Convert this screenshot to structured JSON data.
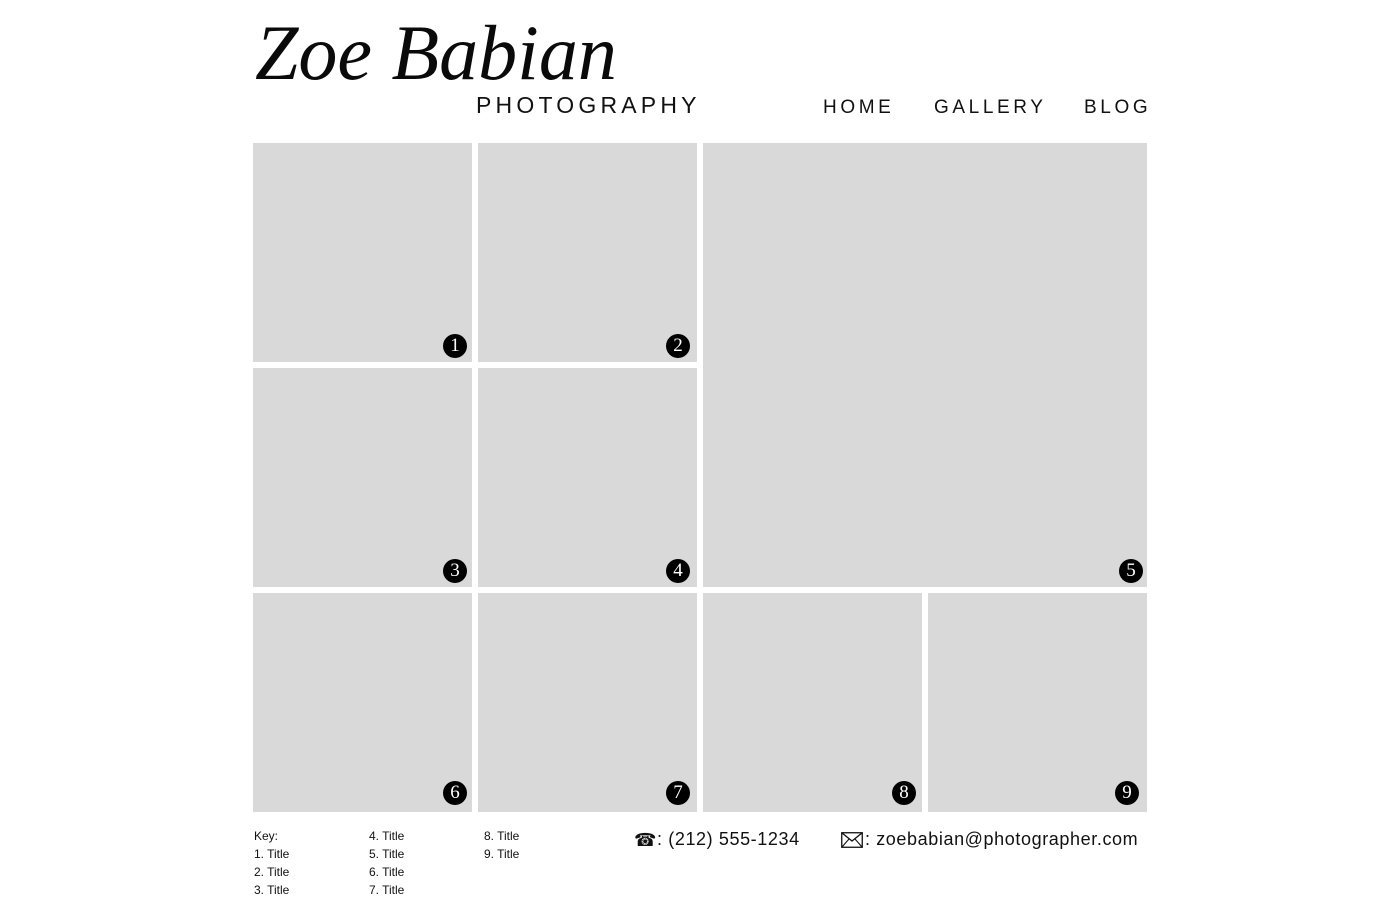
{
  "header": {
    "logo_name": "Zoe Babian",
    "logo_sub": "PHOTOGRAPHY",
    "nav": [
      {
        "label": "HOME"
      },
      {
        "label": "GALLERY"
      },
      {
        "label": "BLOG"
      }
    ]
  },
  "gallery": {
    "tiles": [
      {
        "number": "1"
      },
      {
        "number": "2"
      },
      {
        "number": "3"
      },
      {
        "number": "4"
      },
      {
        "number": "5"
      },
      {
        "number": "6"
      },
      {
        "number": "7"
      },
      {
        "number": "8"
      },
      {
        "number": "9"
      }
    ],
    "tile_color": "#d9d9d9",
    "badge_color": "#000000"
  },
  "footer": {
    "key_heading": "Key:",
    "key_items": [
      "1. Title",
      "2. Title",
      "3. Title",
      "4. Title",
      "5. Title",
      "6. Title",
      "7. Title",
      "8. Title",
      "9. Title"
    ],
    "phone_icon": "☎",
    "phone_text": ": (212) 555-1234",
    "email_text": ": zoebabian@photographer.com"
  },
  "icons": {
    "phone": "telephone-icon",
    "email": "envelope-icon"
  }
}
